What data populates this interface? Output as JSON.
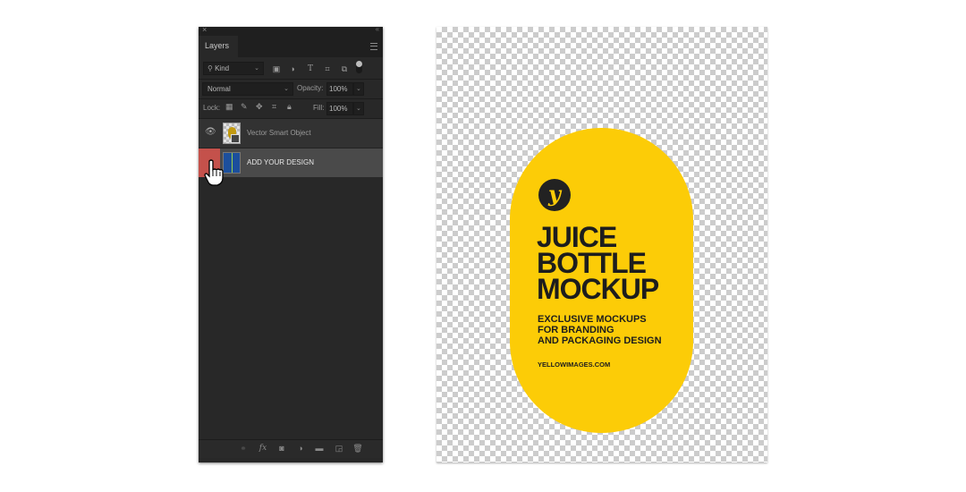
{
  "layers_panel": {
    "close_glyph": "×",
    "collapse_glyph": "‹‹",
    "tab_label": "Layers",
    "filter": {
      "kind_label": "Kind",
      "icons": [
        "pixel-layer-filter-icon",
        "adjustment-layer-filter-icon",
        "type-layer-filter-icon",
        "shape-layer-filter-icon",
        "smart-object-filter-icon"
      ]
    },
    "blend_mode": "Normal",
    "opacity_label": "Opacity:",
    "opacity_value": "100%",
    "lock_label": "Lock:",
    "fill_label": "Fill:",
    "fill_value": "100%",
    "layers": [
      {
        "name": "Vector Smart Object",
        "visible": true,
        "selected": false
      },
      {
        "name": "ADD YOUR DESIGN",
        "visible": false,
        "selected": true
      }
    ],
    "bottom_icons": [
      "link-icon",
      "fx-icon",
      "mask-icon",
      "adjustment-icon",
      "group-folder-icon",
      "new-layer-icon",
      "trash-icon"
    ],
    "fx_label": "fx"
  },
  "canvas": {
    "label_color": "#fccc07",
    "logo_glyph": "y",
    "headline": [
      "JUICE",
      "BOTTLE",
      "MOCKUP"
    ],
    "subline": [
      "EXCLUSIVE MOCKUPS",
      "FOR BRANDING",
      "AND PACKAGING DESIGN"
    ],
    "website": "YELLOWIMAGES.COM"
  }
}
